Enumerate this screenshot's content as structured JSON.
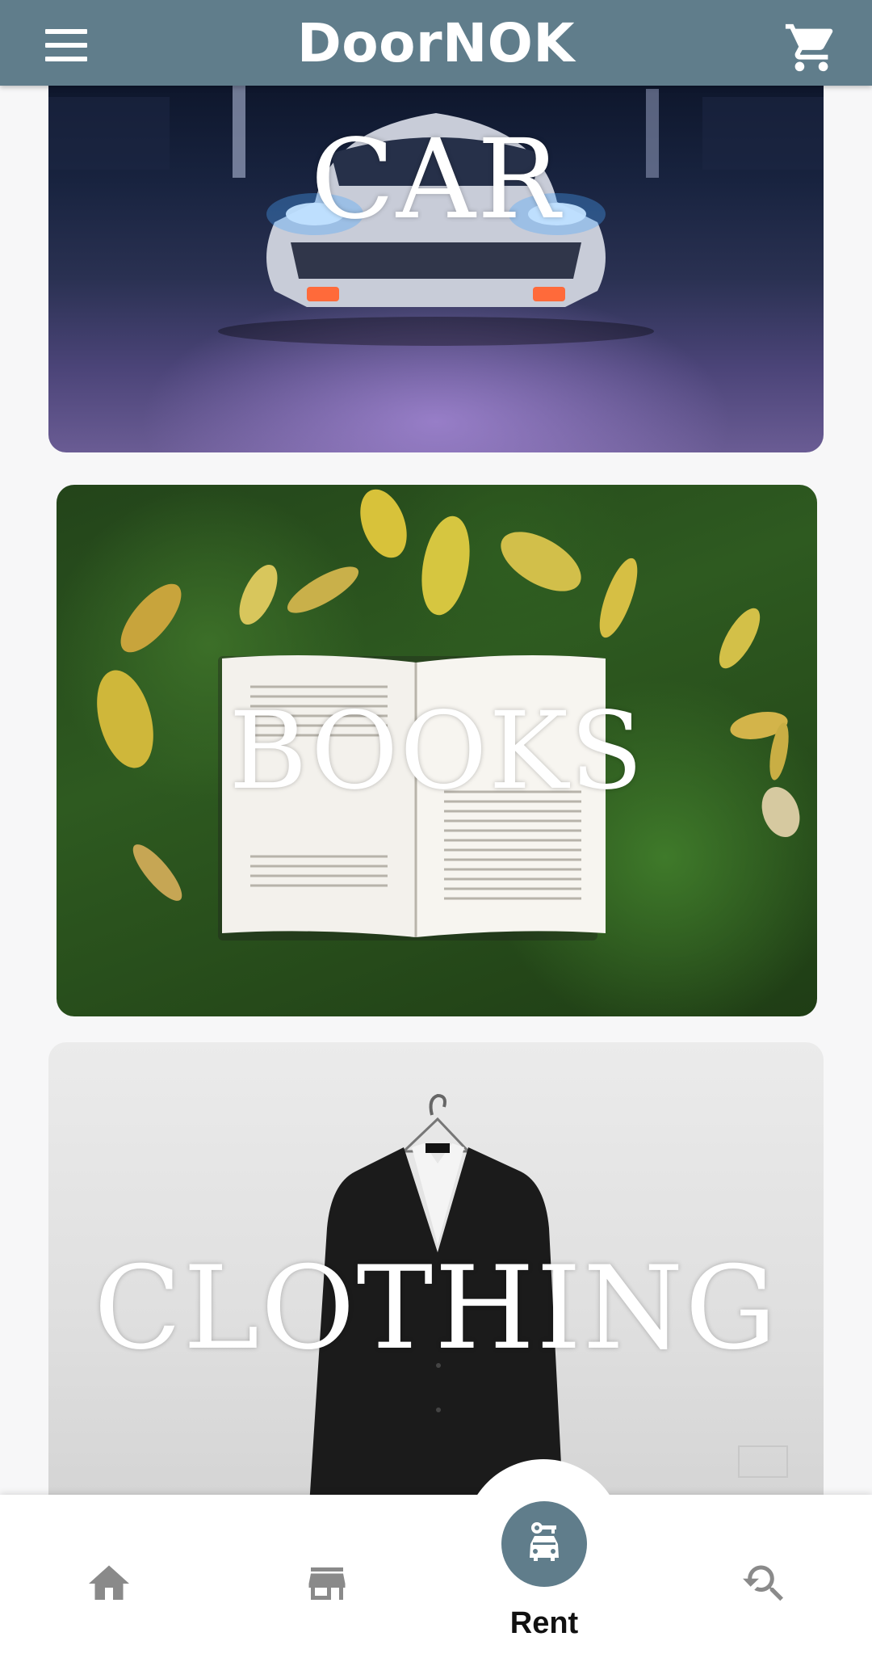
{
  "header": {
    "title": "DoorNOK",
    "menu_icon": "menu-icon",
    "cart_icon": "cart-icon"
  },
  "categories": [
    {
      "label": "CAR"
    },
    {
      "label": "BOOKS"
    },
    {
      "label": "CLOTHING"
    }
  ],
  "bottom_nav": {
    "items": [
      {
        "icon": "home-icon",
        "label": ""
      },
      {
        "icon": "store-icon",
        "label": ""
      },
      {
        "icon": "rent-car-icon",
        "label": "Rent",
        "active": true
      },
      {
        "icon": "search-refresh-icon",
        "label": ""
      }
    ]
  },
  "colors": {
    "primary": "#607d8b",
    "background": "#f7f7f8",
    "nav_background": "#ffffff",
    "nav_icon": "#8a8a8a"
  }
}
